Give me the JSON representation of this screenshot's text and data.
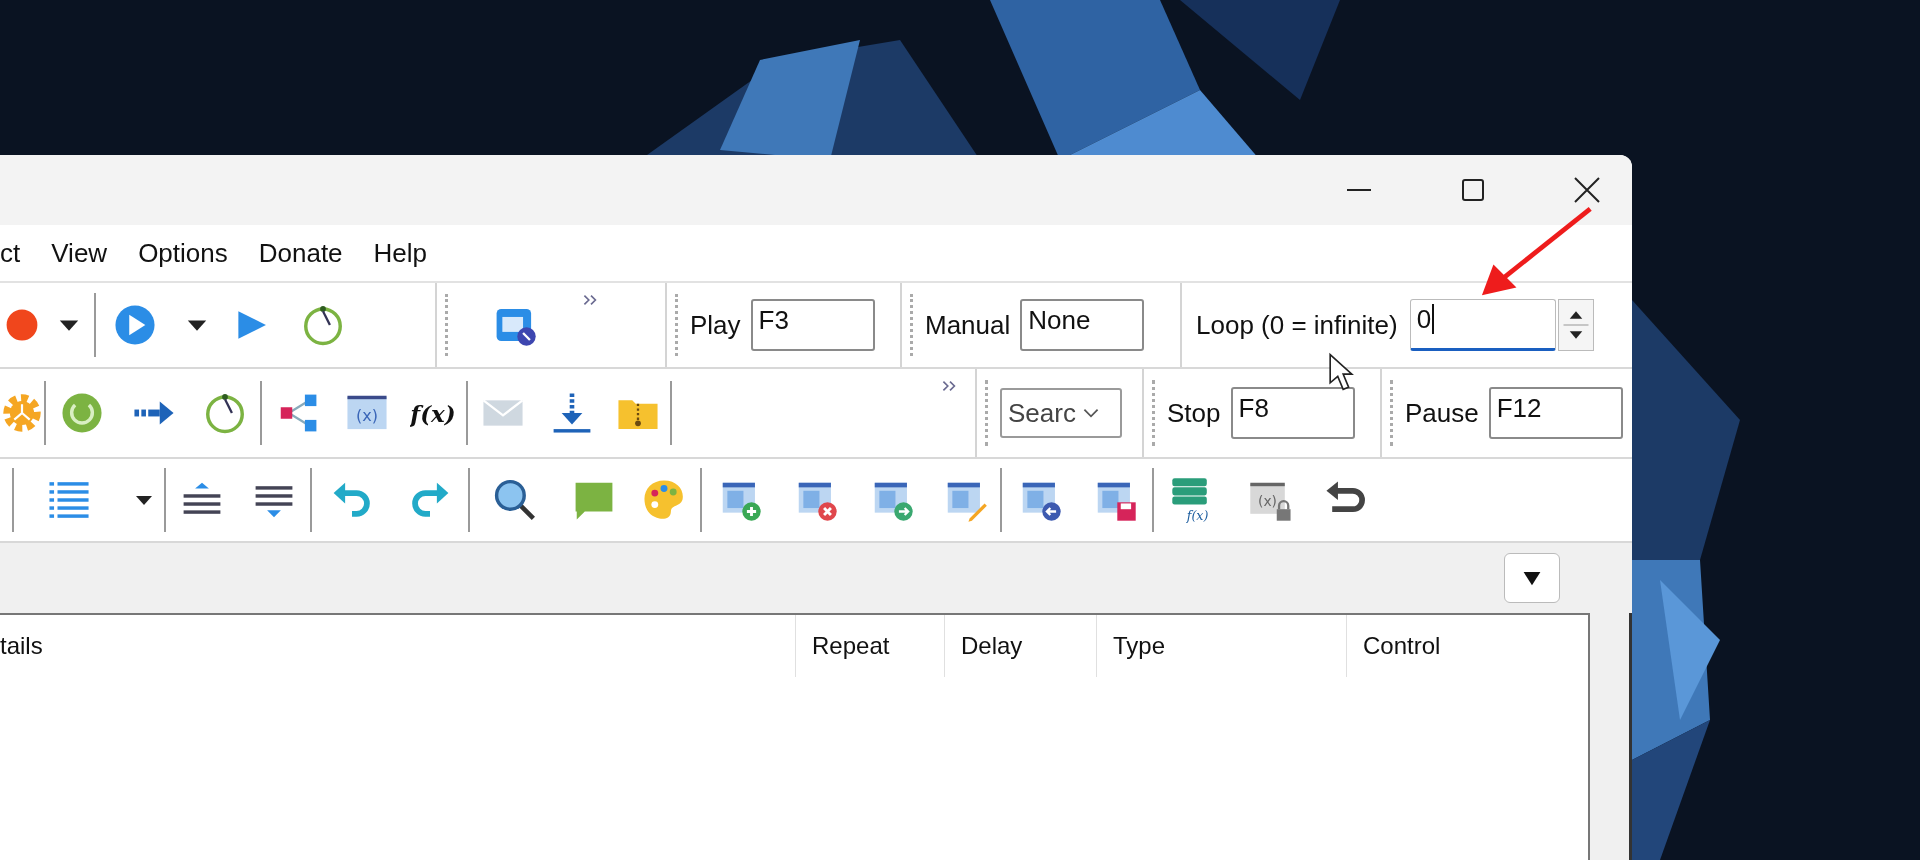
{
  "menu": [
    "ct",
    "View",
    "Options",
    "Donate",
    "Help"
  ],
  "toolbar": {
    "play": {
      "label": "Play",
      "value": "F3"
    },
    "manual": {
      "label": "Manual",
      "value": "None"
    },
    "loop": {
      "label": "Loop (0 = infinite)",
      "value": "0",
      "focused": true
    },
    "search": {
      "value": "Searc"
    },
    "stop": {
      "label": "Stop",
      "value": "F8"
    },
    "pause": {
      "label": "Pause",
      "value": "F12"
    }
  },
  "icon_glyphs": {
    "variables": "(x)",
    "function": "f(x)",
    "function_table": "f(x)",
    "locked_variables": "(x)"
  },
  "list": {
    "columns": [
      "tails",
      "Repeat",
      "Delay",
      "Type",
      "Control"
    ]
  }
}
